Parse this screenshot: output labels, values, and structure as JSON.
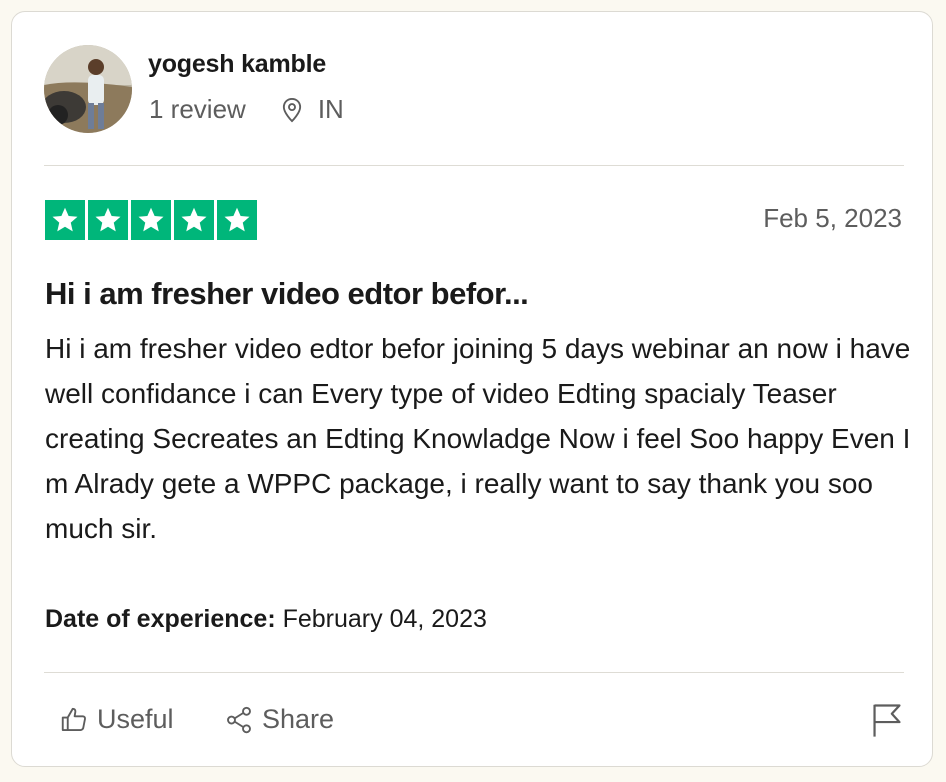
{
  "reviewer": {
    "name": "yogesh kamble",
    "review_count": "1 review",
    "country": "IN"
  },
  "review": {
    "rating": 5,
    "star_color": "#00b67a",
    "date": "Feb 5, 2023",
    "title": "Hi i am fresher video edtor befor...",
    "body": "Hi i am fresher video edtor befor joining 5 days webinar an now i have well confidance i can Every type of video Edting spacialy Teaser creating Secreates an Edting Knowladge Now i feel Soo happy Even I m Alrady gete a WPPC package, i really want to say thank you soo much sir.",
    "experience_label": "Date of experience:",
    "experience_date": "February 04, 2023"
  },
  "actions": {
    "useful_label": "Useful",
    "useful_icon": "thumbs-up-icon",
    "share_label": "Share",
    "share_icon": "share-icon",
    "report_icon": "flag-icon"
  }
}
